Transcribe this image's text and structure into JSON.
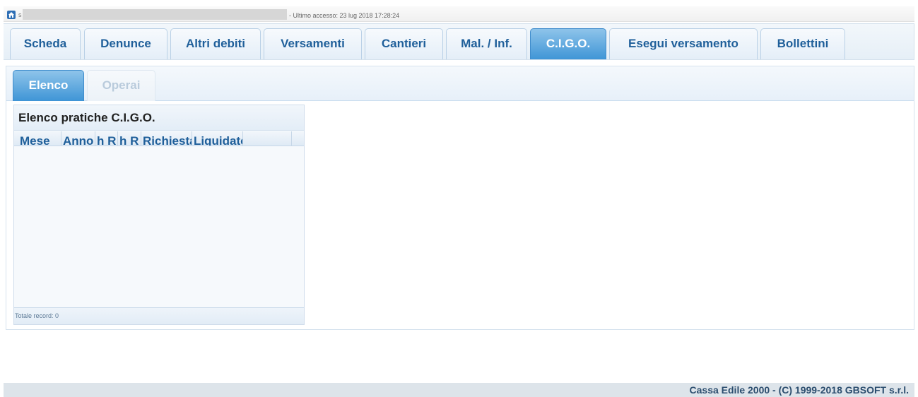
{
  "topbar": {
    "home_icon": "home-icon",
    "user_prefix": "s",
    "last_access": "- Ultimo accesso: 23 lug 2018 17:28:24"
  },
  "main_tabs": [
    {
      "label": "Scheda",
      "active": false
    },
    {
      "label": "Denunce",
      "active": false
    },
    {
      "label": "Altri debiti",
      "active": false
    },
    {
      "label": "Versamenti",
      "active": false
    },
    {
      "label": "Cantieri",
      "active": false
    },
    {
      "label": "Mal. / Inf.",
      "active": false
    },
    {
      "label": "C.I.G.O.",
      "active": true
    },
    {
      "label": "Esegui versamento",
      "active": false
    },
    {
      "label": "Bollettini",
      "active": false
    }
  ],
  "sub_tabs": [
    {
      "label": "Elenco",
      "active": true
    },
    {
      "label": "Operai",
      "active": false,
      "disabled": true
    }
  ],
  "grid": {
    "title": "Elenco pratiche C.I.G.O.",
    "columns": [
      "Mese",
      "Anno",
      "h R",
      "h R",
      "Richiesta",
      "Liquidato"
    ],
    "rows": [],
    "footer": "Totale record: 0"
  },
  "footer": {
    "copyright": "Cassa Edile 2000 - (C) 1999-2018 GBSOFT s.r.l."
  },
  "colors": {
    "accent": "#3f95d6",
    "tab_text": "#1f5f9a",
    "footer_text": "#2b4d6e"
  }
}
